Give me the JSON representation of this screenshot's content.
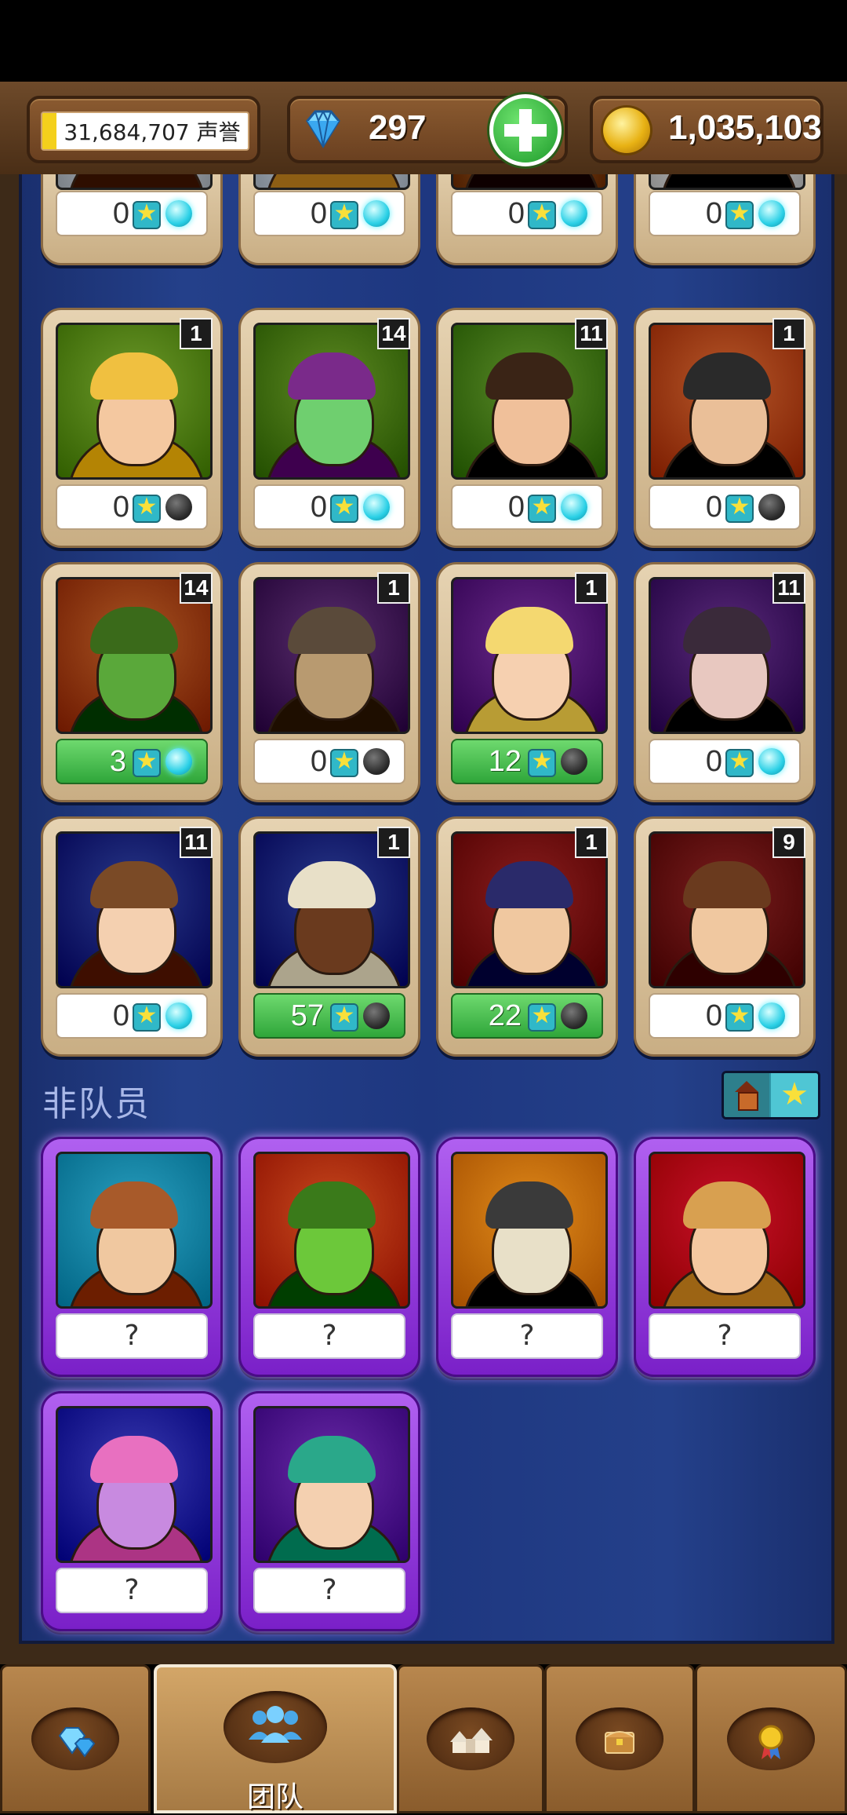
{
  "resources": {
    "fame": "31,684,707 声誉",
    "gems": "297",
    "gold": "1,035,103"
  },
  "team_cards": [
    {
      "level": "",
      "stars": "0",
      "orb": "cyan",
      "bg": "#b7bdc4",
      "skin": "#f3c9a4",
      "hair": "#6a4a2a",
      "clipped": true
    },
    {
      "level": "",
      "stars": "0",
      "orb": "cyan",
      "bg": "#b9c2cc",
      "skin": "#f2c8a0",
      "hair": "#c99a50",
      "clipped": true
    },
    {
      "level": "",
      "stars": "0",
      "orb": "cyan",
      "bg": "#8a5a2a",
      "skin": "#a77a50",
      "hair": "#4a2a18",
      "clipped": true
    },
    {
      "level": "",
      "stars": "0",
      "orb": "cyan",
      "bg": "#c8c8c8",
      "skin": "#f0c8a0",
      "hair": "#2a1a10",
      "clipped": true
    },
    {
      "level": "1",
      "stars": "0",
      "orb": "dark",
      "bg": "#6d9a2a",
      "skin": "#f4c8a0",
      "hair": "#f0c040"
    },
    {
      "level": "14",
      "stars": "0",
      "orb": "cyan",
      "bg": "#5e8a22",
      "skin": "#6fcf6f",
      "hair": "#7a2a8a"
    },
    {
      "level": "11",
      "stars": "0",
      "orb": "cyan",
      "bg": "#5a8a28",
      "skin": "#f0c09a",
      "hair": "#3a2416"
    },
    {
      "level": "1",
      "stars": "0",
      "orb": "dark",
      "bg": "#b7582a",
      "skin": "#eabf98",
      "hair": "#2a2a2a"
    },
    {
      "level": "14",
      "stars": "3",
      "orb": "cyan",
      "bg": "#a85422",
      "skin": "#5aa83a",
      "hair": "#3a6a1a",
      "green": true
    },
    {
      "level": "1",
      "stars": "0",
      "orb": "dark",
      "bg": "#5a2e6e",
      "skin": "#b89a70",
      "hair": "#5a4a3a"
    },
    {
      "level": "1",
      "stars": "12",
      "orb": "dark",
      "bg": "#6a2a8a",
      "skin": "#f6d0b0",
      "hair": "#f4d870",
      "green": true
    },
    {
      "level": "11",
      "stars": "0",
      "orb": "cyan",
      "bg": "#5a2a7a",
      "skin": "#e8c8c0",
      "hair": "#3a2a3a"
    },
    {
      "level": "11",
      "stars": "0",
      "orb": "cyan",
      "bg": "#2a3a8a",
      "skin": "#f4d0b0",
      "hair": "#7a4a26"
    },
    {
      "level": "1",
      "stars": "57",
      "orb": "dark",
      "bg": "#2a3a8a",
      "skin": "#6a3a1e",
      "hair": "#e8e0c8",
      "green": true
    },
    {
      "level": "1",
      "stars": "22",
      "orb": "dark",
      "bg": "#8a1e1e",
      "skin": "#f0c8a0",
      "hair": "#2a2a6a",
      "green": true
    },
    {
      "level": "9",
      "stars": "0",
      "orb": "cyan",
      "bg": "#7a1e1e",
      "skin": "#f0c8a0",
      "hair": "#6a3a1e"
    }
  ],
  "non_members_title": "非队员",
  "non_member_cards": [
    {
      "label": "?",
      "bg": "#2aa0c0",
      "skin": "#f0c8a0",
      "hair": "#a85a2a"
    },
    {
      "label": "?",
      "bg": "#c84a1e",
      "skin": "#6cc83a",
      "hair": "#3a7a1a"
    },
    {
      "label": "?",
      "bg": "#e08a1a",
      "skin": "#e8e0c8",
      "hair": "#3a3a3a"
    },
    {
      "label": "?",
      "bg": "#c8102a",
      "skin": "#f4c8a0",
      "hair": "#d8a050"
    },
    {
      "label": "?",
      "bg": "#3a3ab0",
      "skin": "#c88ae0",
      "hair": "#e870c0"
    },
    {
      "label": "?",
      "bg": "#6a2aa8",
      "skin": "#f4d0b0",
      "hair": "#2aa88a"
    }
  ],
  "nav": {
    "team_label": "团队",
    "tabs": [
      {
        "name": "gems",
        "icon": "gem-icon"
      },
      {
        "name": "team",
        "icon": "team-icon"
      },
      {
        "name": "town",
        "icon": "buildings-icon"
      },
      {
        "name": "chest",
        "icon": "treasure-chest-icon"
      },
      {
        "name": "awards",
        "icon": "medal-icon"
      }
    ]
  }
}
